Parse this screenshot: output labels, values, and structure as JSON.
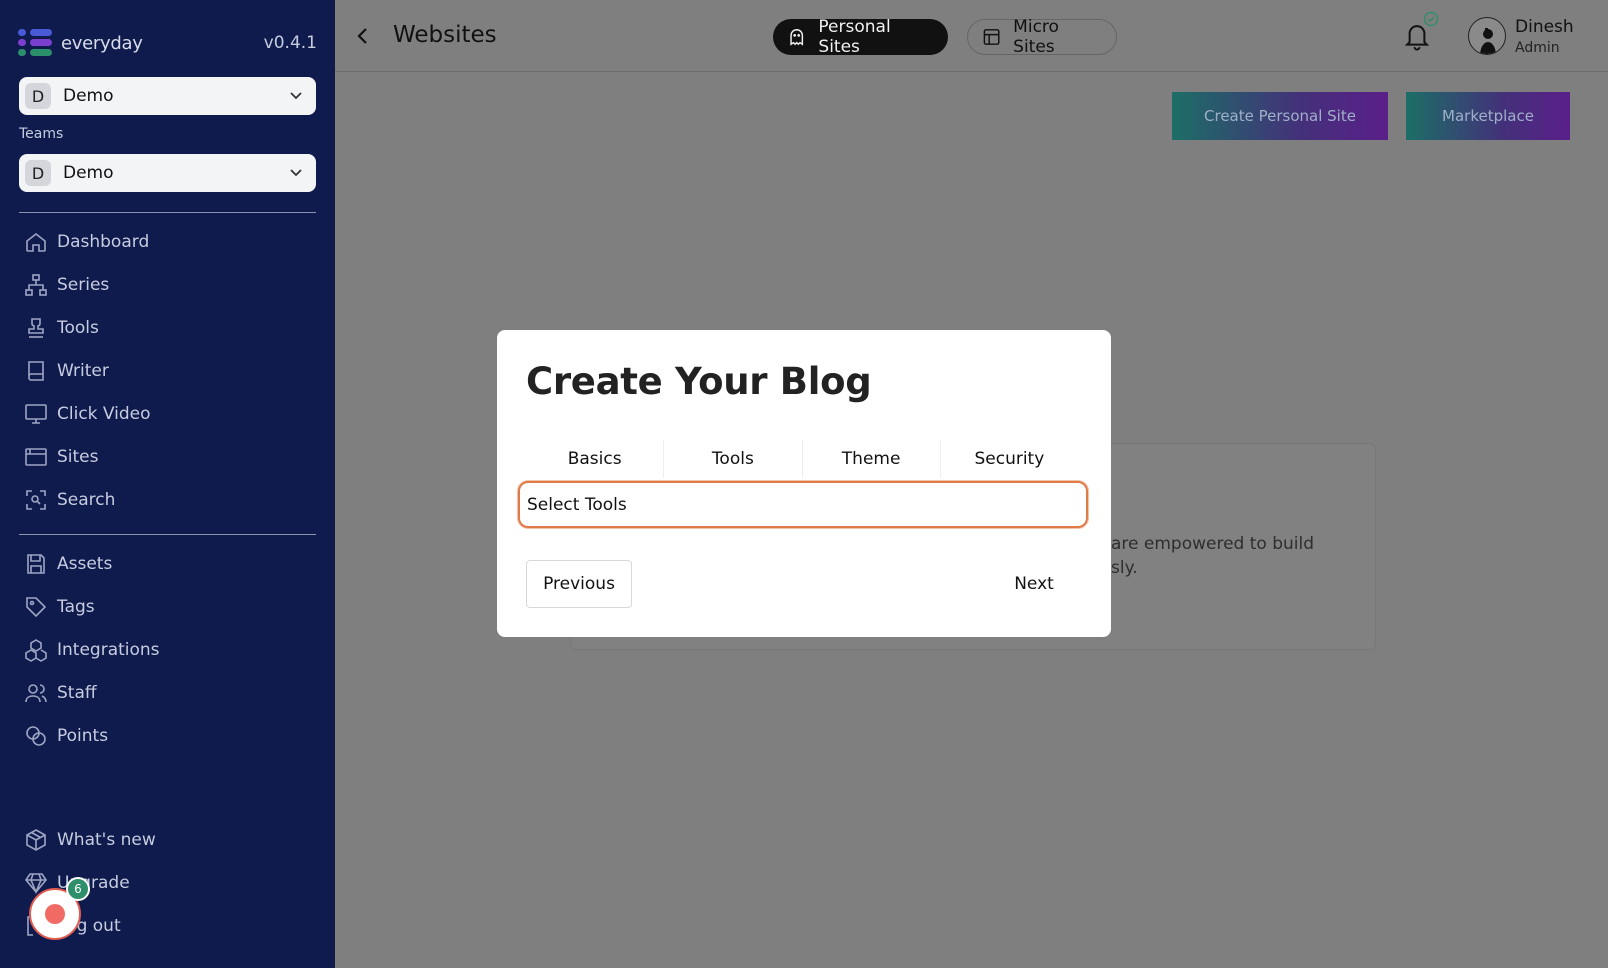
{
  "sidebar": {
    "brand": "everyday",
    "version": "v0.4.1",
    "workspace": {
      "initial": "D",
      "label": "Demo"
    },
    "teams_label": "Teams",
    "team": {
      "initial": "D",
      "label": "Demo"
    },
    "nav": [
      {
        "label": "Dashboard",
        "icon": "home-icon"
      },
      {
        "label": "Series",
        "icon": "sitemap-icon"
      },
      {
        "label": "Tools",
        "icon": "stamp-icon"
      },
      {
        "label": "Writer",
        "icon": "book-icon"
      },
      {
        "label": "Click Video",
        "icon": "monitor-icon"
      },
      {
        "label": "Sites",
        "icon": "browser-icon"
      },
      {
        "label": "Search",
        "icon": "scan-search-icon"
      }
    ],
    "nav2": [
      {
        "label": "Assets",
        "icon": "save-icon"
      },
      {
        "label": "Tags",
        "icon": "tag-icon"
      },
      {
        "label": "Integrations",
        "icon": "blocks-icon"
      },
      {
        "label": "Staff",
        "icon": "users-icon"
      },
      {
        "label": "Points",
        "icon": "coins-icon"
      }
    ],
    "bottom": [
      {
        "label": "What's new",
        "icon": "package-icon"
      },
      {
        "label": "Upgrade",
        "icon": "diamond-icon"
      },
      {
        "label": "Log out",
        "icon": "logout-icon"
      }
    ],
    "fab_badge": "6"
  },
  "header": {
    "title": "Websites",
    "tabs": [
      "Personal Sites",
      "Micro Sites"
    ],
    "user": {
      "name": "Dinesh",
      "role": "Admin"
    }
  },
  "actions": {
    "create": "Create Personal Site",
    "marketplace": "Marketplace"
  },
  "background_card": {
    "line1": "are empowered to build",
    "line2": "sly."
  },
  "modal": {
    "title": "Create Your Blog",
    "tabs": [
      "Basics",
      "Tools",
      "Theme",
      "Security"
    ],
    "input_value": "Select Tools",
    "previous": "Previous",
    "next": "Next"
  },
  "colors": {
    "sidebar": "#0f1b4c",
    "accent_border": "#e07a48",
    "badge": "#2f8f6b"
  }
}
